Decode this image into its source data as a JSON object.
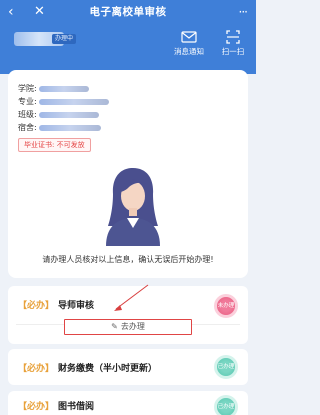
{
  "nav": {
    "back_icon": "‹",
    "close_icon": "✕",
    "title": "电子离校单审核",
    "more_icon": "···"
  },
  "banner": {
    "status_tag": "办理中",
    "notify_label": "消息通知",
    "scan_label": "扫一扫"
  },
  "info": {
    "college_label": "学院:",
    "major_label": "专业:",
    "class_label": "班级:",
    "dorm_label": "宿舍:",
    "graduation_label": "毕业证书: 不可发放",
    "notice": "请办理人员核对以上信息，确认无误后开始办理!"
  },
  "tasks": [
    {
      "required": "【必办】",
      "name": "导师审核",
      "stamp": "未办理",
      "button": "去办理"
    },
    {
      "required": "【必办】",
      "name": "财务缴费（半小时更新）",
      "stamp": "已办理"
    },
    {
      "required": "【必办】",
      "name": "图书借阅",
      "stamp": "已办理"
    }
  ],
  "colors": {
    "primary": "#3f7fd8",
    "required": "#e8a13a",
    "alert": "#e54545",
    "pending": "#e95a7f",
    "done": "#55c6ae"
  }
}
